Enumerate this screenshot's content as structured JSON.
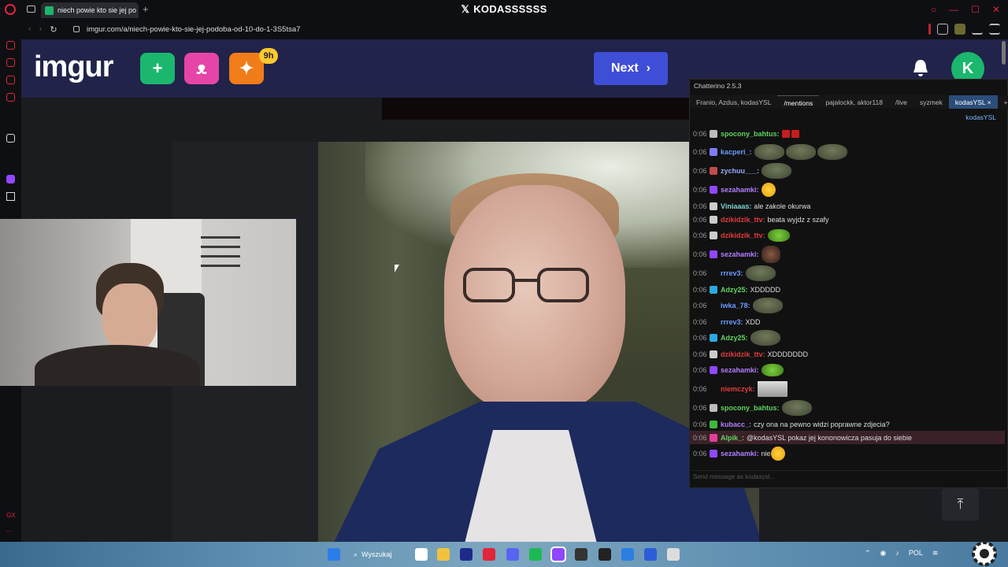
{
  "browser": {
    "tab_title": "niech powie kto sie jej po",
    "window_title": "KODASSSSSS",
    "url": "imgur.com/a/niech-powie-kto-sie-jej-podoba-od-10-do-1-3S5tsa7"
  },
  "imgur": {
    "logo": "imgur",
    "badge": "9h",
    "next_label": "Next",
    "avatar_letter": "K",
    "colors": {
      "header_bg": "#21234a",
      "next_bg": "#3f4ed6",
      "avatar_bg": "#1bb76e"
    }
  },
  "chat": {
    "app_title": "Chatterino 2.5.3",
    "tabs": [
      "Franio, Azdus, kodasYSL",
      "/mentions",
      "pajalockk, aktor118",
      "/live",
      "syzmek",
      "kodasYSL"
    ],
    "active_tab_close": "×",
    "add_tab": "+",
    "channel": "kodasYSL",
    "input_placeholder": "Send message as kodasysl...",
    "messages": [
      {
        "ts": "0:06",
        "user": "spocony_bahtus:",
        "color": "#5fd45f",
        "text": "",
        "emotes": [
          "red",
          "red"
        ],
        "h": 22,
        "badge": "#bbb"
      },
      {
        "ts": "0:06",
        "user": "kacperi_:",
        "color": "#6a9bff",
        "text": "",
        "emotes": [
          "pepe",
          "pepe",
          "pepe"
        ],
        "h": 24,
        "badge": "#7d7dff"
      },
      {
        "ts": "0:06",
        "user": "zychuu___:",
        "color": "#9aa8ff",
        "text": "",
        "emotes": [
          "pepe"
        ],
        "h": 24,
        "badge": "#c24a4a"
      },
      {
        "ts": "0:06",
        "user": "sezahamki:",
        "color": "#b37dff",
        "text": "",
        "emotes": [
          "yellow"
        ],
        "h": 24,
        "badge": "#9146ff"
      },
      {
        "ts": "0:06",
        "user": "Viniaaas:",
        "color": "#7bd4d4",
        "text": "ale zakole okurwa",
        "emotes": [],
        "h": 17,
        "badge": "#ccc"
      },
      {
        "ts": "0:06",
        "user": "dzikidzik_ttv:",
        "color": "#e03c3c",
        "text": "beata wyjdz z szafy",
        "emotes": [],
        "h": 17,
        "badge": "#ccc"
      },
      {
        "ts": "0:06",
        "user": "dzikidzik_ttv:",
        "color": "#e03c3c",
        "text": "",
        "emotes": [
          "green"
        ],
        "h": 24,
        "badge": "#ccc"
      },
      {
        "ts": "0:06",
        "user": "sezahamki:",
        "color": "#b37dff",
        "text": "",
        "emotes": [
          "pers"
        ],
        "h": 24,
        "badge": "#9146ff"
      },
      {
        "ts": "0:06",
        "user": "rrrev3:",
        "color": "#6a9bff",
        "text": "",
        "emotes": [
          "pepe"
        ],
        "h": 24,
        "badge": ""
      },
      {
        "ts": "0:06",
        "user": "Adzy25:",
        "color": "#5fd45f",
        "text": "XDDDDD",
        "emotes": [],
        "h": 17,
        "badge": "#2aa9e0"
      },
      {
        "ts": "0:06",
        "user": "iwka_78:",
        "color": "#6a9bff",
        "text": "",
        "emotes": [
          "pepe"
        ],
        "h": 24,
        "badge": ""
      },
      {
        "ts": "0:06",
        "user": "rrrev3:",
        "color": "#6a9bff",
        "text": "XDD",
        "emotes": [],
        "h": 17,
        "badge": ""
      },
      {
        "ts": "0:06",
        "user": "Adzy25:",
        "color": "#5fd45f",
        "text": "",
        "emotes": [
          "pepe"
        ],
        "h": 24,
        "badge": "#2aa9e0"
      },
      {
        "ts": "0:06",
        "user": "dzikidzik_ttv:",
        "color": "#e03c3c",
        "text": "XDDDDDDD",
        "emotes": [],
        "h": 17,
        "badge": "#ccc"
      },
      {
        "ts": "0:06",
        "user": "sezahamki:",
        "color": "#b37dff",
        "text": "",
        "emotes": [
          "green"
        ],
        "h": 24,
        "badge": "#9146ff"
      },
      {
        "ts": "0:06",
        "user": "niemczyk:",
        "color": "#e03c3c",
        "text": "",
        "emotes": [
          "pic"
        ],
        "h": 24,
        "badge": ""
      },
      {
        "ts": "0:06",
        "user": "spocony_bahtus:",
        "color": "#5fd45f",
        "text": "",
        "emotes": [
          "pepe"
        ],
        "h": 24,
        "badge": "#bbb"
      },
      {
        "ts": "0:06",
        "user": "kubacc_:",
        "color": "#b37dff",
        "text": "czy ona na pewno widzi poprawne zdjecia?",
        "emotes": [],
        "h": 17,
        "badge": "#3cb83c"
      },
      {
        "ts": "0:06",
        "user": "Alpik_:",
        "color": "#5fd45f",
        "text": "@kodasYSL pokaz jej kononowicza pasuja do siebie",
        "emotes": [],
        "h": 17,
        "badge": "#e0409a",
        "highlight": true
      },
      {
        "ts": "0:06",
        "user": "sezahamki:",
        "color": "#b37dff",
        "text": "nie",
        "emotes": [
          "yellow"
        ],
        "h": 24,
        "badge": "#9146ff"
      }
    ]
  },
  "taskbar": {
    "search_label": "Wyszukaj",
    "lang": "POL",
    "icon_colors": [
      "#2b7de9",
      "#ffffff",
      "#f0c23c",
      "#1e2a8a",
      "#e0263a",
      "#5865f2",
      "#1db954",
      "#9146ff",
      "#333333",
      "#222222",
      "#2a7fe0",
      "#2b5dd8",
      "#dddddd"
    ]
  }
}
